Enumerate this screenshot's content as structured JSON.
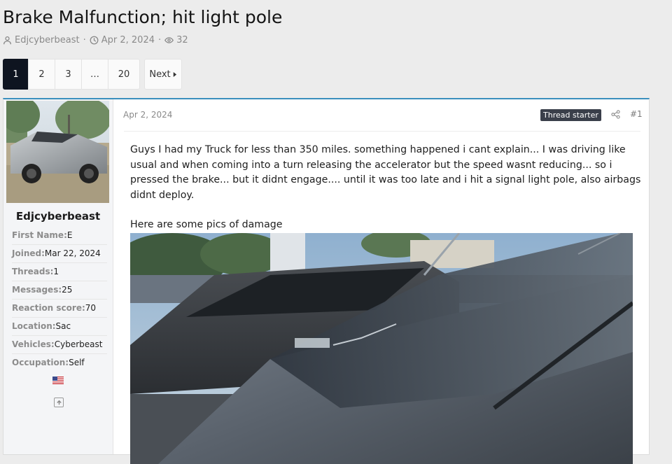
{
  "thread": {
    "title": "Brake Malfunction; hit light pole",
    "author": "Edjcyberbeast",
    "date": "Apr 2, 2024",
    "views": "32"
  },
  "pagination": {
    "pages": [
      "1",
      "2",
      "3",
      "…",
      "20"
    ],
    "current": "1",
    "next_label": "Next"
  },
  "user": {
    "name": "Edjcyberbeast",
    "stats": [
      {
        "label": "First Name:",
        "value": "E"
      },
      {
        "label": "Joined:",
        "value": "Mar 22, 2024"
      },
      {
        "label": "Threads:",
        "value": "1"
      },
      {
        "label": "Messages:",
        "value": "25"
      },
      {
        "label": "Reaction score:",
        "value": "70"
      },
      {
        "label": "Location:",
        "value": "Sac"
      },
      {
        "label": "Vehicles:",
        "value": "Cyberbeast"
      },
      {
        "label": "Occupation:",
        "value": "Self"
      }
    ],
    "flag_icon": "us-flag-icon"
  },
  "post": {
    "date": "Apr 2, 2024",
    "badge": "Thread starter",
    "number": "#1",
    "paragraphs": [
      "Guys I had my Truck for less than 350 miles. something happened i cant explain... I was driving like usual and when coming into a turn releasing the accelerator but the speed wasnt reducing... so i pressed the brake... but it didnt engage.... until it was too late and i hit a signal light pole, also airbags didnt deploy.",
      "Here are some pics of damage"
    ]
  },
  "colors": {
    "active_page": "#0e1420",
    "post_top_border": "#3a8fbd",
    "badge_bg": "#3a3f4a"
  }
}
